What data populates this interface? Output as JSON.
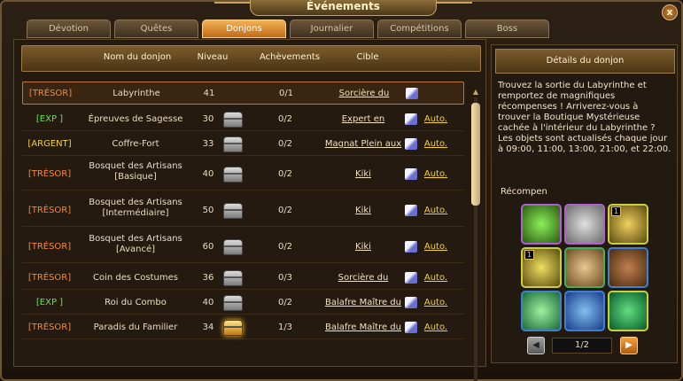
{
  "window": {
    "title": "Événements",
    "close_label": "x"
  },
  "tabs": [
    "Dévotion",
    "Quêtes",
    "Donjons",
    "Journalier",
    "Compétitions",
    "Boss"
  ],
  "active_tab": "Donjons",
  "table": {
    "headers": {
      "name": "Nom du donjon",
      "level": "Niveau",
      "achievements": "Achèvements",
      "target": "Cible"
    },
    "rows": [
      {
        "tag": "[TRÉSOR]",
        "tag_type": "tresor",
        "name": "Labyrinthe",
        "level": "41",
        "chest": "none",
        "achievements": "0/1",
        "target": "Sorcière du",
        "auto": ""
      },
      {
        "tag": "[EXP ]",
        "tag_type": "exp",
        "name": "Épreuves de Sagesse",
        "level": "30",
        "chest": "silver",
        "achievements": "0/2",
        "target": "Expert en",
        "auto": "Auto."
      },
      {
        "tag": "[ARGENT]",
        "tag_type": "argent",
        "name": "Coffre-Fort",
        "level": "33",
        "chest": "silver",
        "achievements": "0/2",
        "target": "Magnat Plein aux",
        "auto": "Auto."
      },
      {
        "tag": "[TRÉSOR]",
        "tag_type": "tresor",
        "name": "Bosquet des Artisans [Basique]",
        "level": "40",
        "chest": "silver",
        "achievements": "0/2",
        "target": "Kiki",
        "auto": "Auto."
      },
      {
        "tag": "[TRÉSOR]",
        "tag_type": "tresor",
        "name": "Bosquet des Artisans [Intermédiaire]",
        "level": "50",
        "chest": "silver",
        "achievements": "0/2",
        "target": "Kiki",
        "auto": "Auto."
      },
      {
        "tag": "[TRÉSOR]",
        "tag_type": "tresor",
        "name": "Bosquet des Artisans [Avancé]",
        "level": "60",
        "chest": "silver",
        "achievements": "0/2",
        "target": "Kiki",
        "auto": "Auto."
      },
      {
        "tag": "[TRÉSOR]",
        "tag_type": "tresor",
        "name": "Coin des Costumes",
        "level": "36",
        "chest": "silver",
        "achievements": "0/3",
        "target": "Sorcière du",
        "auto": "Auto."
      },
      {
        "tag": "[EXP ]",
        "tag_type": "exp",
        "name": "Roi du Combo",
        "level": "40",
        "chest": "silver",
        "achievements": "0/2",
        "target": "Balafre Maître du",
        "auto": "Auto."
      },
      {
        "tag": "[TRÉSOR]",
        "tag_type": "tresor",
        "name": "Paradis du Familier",
        "level": "34",
        "chest": "gold",
        "achievements": "1/3",
        "target": "Balafre Maître du",
        "auto": "Auto."
      }
    ]
  },
  "details": {
    "header": "Détails du donjon",
    "description": "Trouvez la sortie du Labyrinthe et remportez de magnifiques récompenses ! Arriverez-vous à trouver la Boutique Mystérieuse cachée à l'intérieur du Labyrinthe ? Les objets sont actualisés chaque jour à 09:00, 11:00, 13:00, 21:00, et 22:00.",
    "rewards_label": "Récompen",
    "rewards": [
      {
        "icon": "exp-orb-icon",
        "badge": ""
      },
      {
        "icon": "silver-coin-icon",
        "badge": ""
      },
      {
        "icon": "gold-shards-icon",
        "badge": "1"
      },
      {
        "icon": "gold-crystal-icon",
        "badge": "1"
      },
      {
        "icon": "scroll-icon",
        "badge": ""
      },
      {
        "icon": "book-icon",
        "badge": ""
      },
      {
        "icon": "green-leaf-icon",
        "badge": ""
      },
      {
        "icon": "blue-card-icon",
        "badge": ""
      },
      {
        "icon": "green-gem-icon",
        "badge": ""
      }
    ],
    "pager": {
      "text": "1/2"
    }
  },
  "colors": {
    "accent": "#f4b455",
    "tresor": "#f08a3c",
    "exp": "#6fe05a",
    "argent": "#f5d23a"
  }
}
